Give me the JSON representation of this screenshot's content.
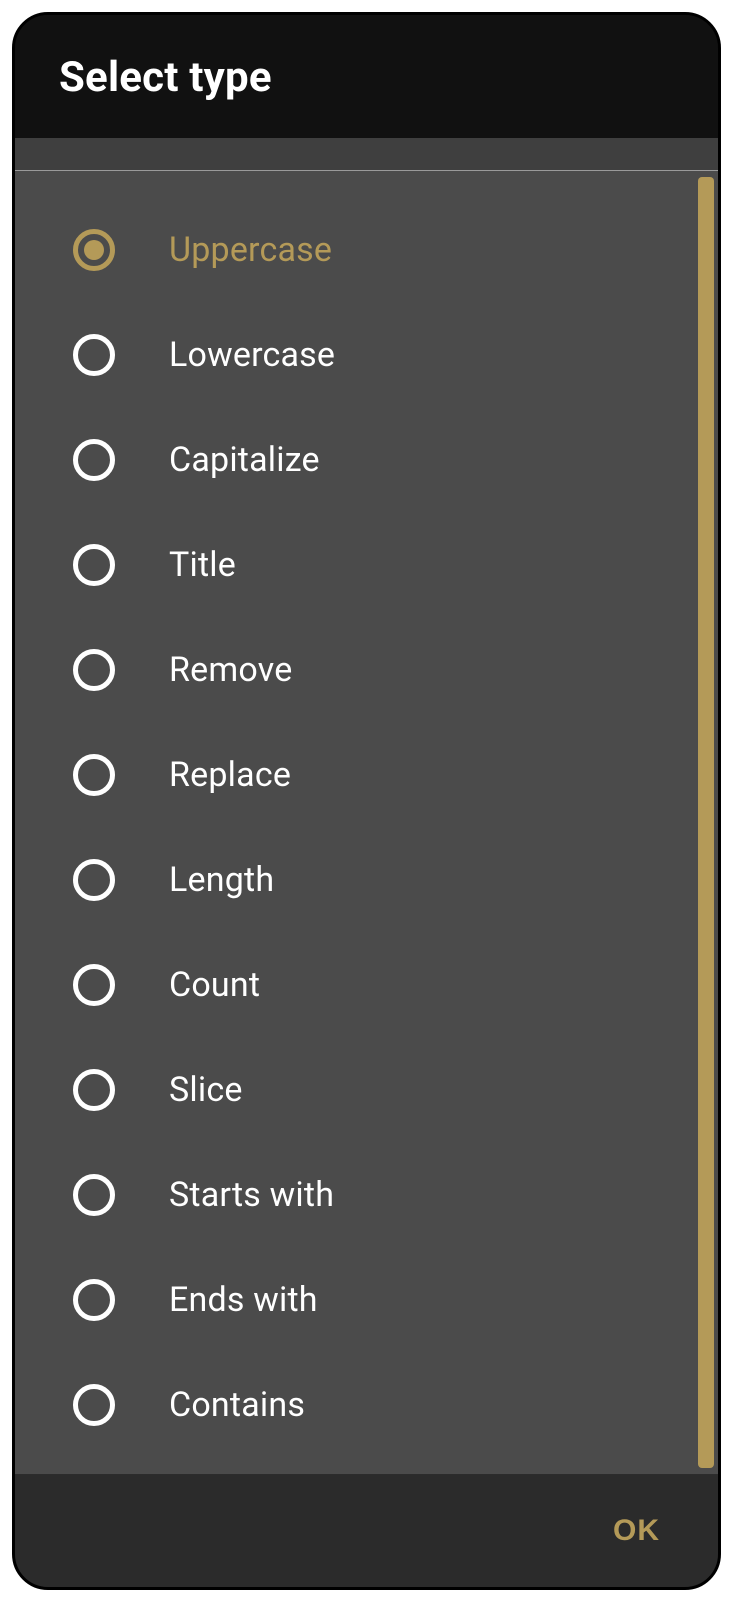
{
  "header": {
    "title": "Select type"
  },
  "options": [
    {
      "label": "Uppercase",
      "selected": true
    },
    {
      "label": "Lowercase",
      "selected": false
    },
    {
      "label": "Capitalize",
      "selected": false
    },
    {
      "label": "Title",
      "selected": false
    },
    {
      "label": "Remove",
      "selected": false
    },
    {
      "label": "Replace",
      "selected": false
    },
    {
      "label": "Length",
      "selected": false
    },
    {
      "label": "Count",
      "selected": false
    },
    {
      "label": "Slice",
      "selected": false
    },
    {
      "label": "Starts with",
      "selected": false
    },
    {
      "label": "Ends with",
      "selected": false
    },
    {
      "label": "Contains",
      "selected": false
    }
  ],
  "footer": {
    "ok": "OK"
  },
  "colors": {
    "accent": "#b49a58"
  }
}
